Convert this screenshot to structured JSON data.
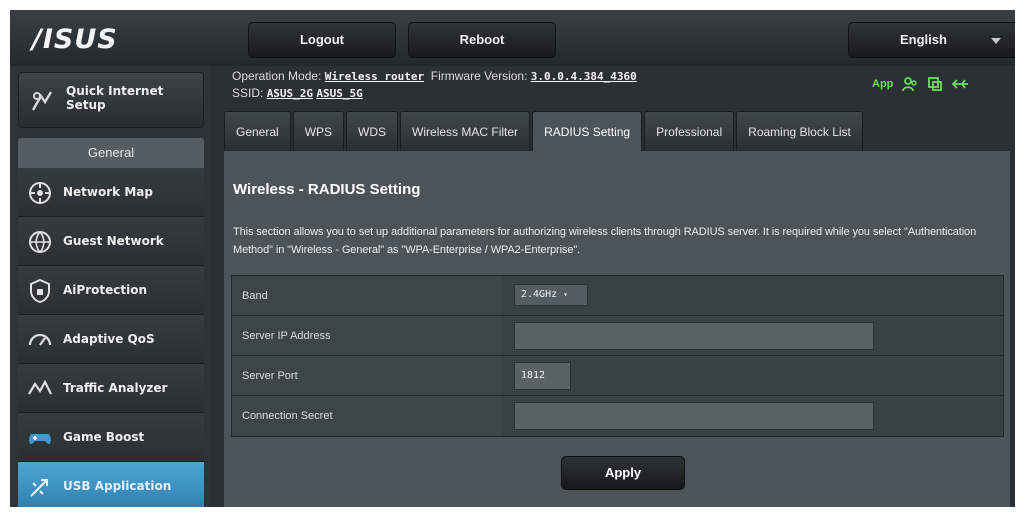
{
  "header": {
    "logo": "/ISUS",
    "logout_label": "Logout",
    "reboot_label": "Reboot",
    "language": "English"
  },
  "sidebar": {
    "quick_setup": "Quick Internet Setup",
    "section_title": "General",
    "items": [
      {
        "label": "Network Map",
        "icon": "network-map-icon"
      },
      {
        "label": "Guest Network",
        "icon": "guest-network-icon"
      },
      {
        "label": "AiProtection",
        "icon": "shield-icon"
      },
      {
        "label": "Adaptive QoS",
        "icon": "speedometer-icon"
      },
      {
        "label": "Traffic Analyzer",
        "icon": "traffic-icon"
      },
      {
        "label": "Game Boost",
        "icon": "gamepad-icon"
      },
      {
        "label": "USB Application",
        "icon": "usb-icon"
      }
    ],
    "active_index": 6
  },
  "info": {
    "op_mode_label": "Operation Mode:",
    "op_mode_value": "Wireless router",
    "fw_label": "Firmware Version:",
    "fw_value": "3.0.0.4.384_4360",
    "ssid_label": "SSID:",
    "ssid_1": "ASUS_2G",
    "ssid_2": "ASUS_5G",
    "app_label": "App"
  },
  "tabs": [
    {
      "label": "General"
    },
    {
      "label": "WPS"
    },
    {
      "label": "WDS"
    },
    {
      "label": "Wireless MAC Filter"
    },
    {
      "label": "RADIUS Setting"
    },
    {
      "label": "Professional"
    },
    {
      "label": "Roaming Block List"
    }
  ],
  "active_tab": 4,
  "content": {
    "title": "Wireless - RADIUS Setting",
    "description": "This section allows you to set up additional parameters for authorizing wireless clients through RADIUS server. It is required while you select \"Authentication Method\" in \"Wireless - General\" as \"WPA-Enterprise / WPA2-Enterprise\".",
    "fields": {
      "band_label": "Band",
      "band_value": "2.4GHz",
      "server_ip_label": "Server IP Address",
      "server_ip_value": "",
      "server_port_label": "Server Port",
      "server_port_value": "1812",
      "secret_label": "Connection Secret",
      "secret_value": ""
    },
    "apply_label": "Apply"
  },
  "colors": {
    "background": "#2b3033",
    "panel": "#4d5459",
    "active_blue": "#3a8fc1",
    "status_green": "#6ae05a"
  }
}
